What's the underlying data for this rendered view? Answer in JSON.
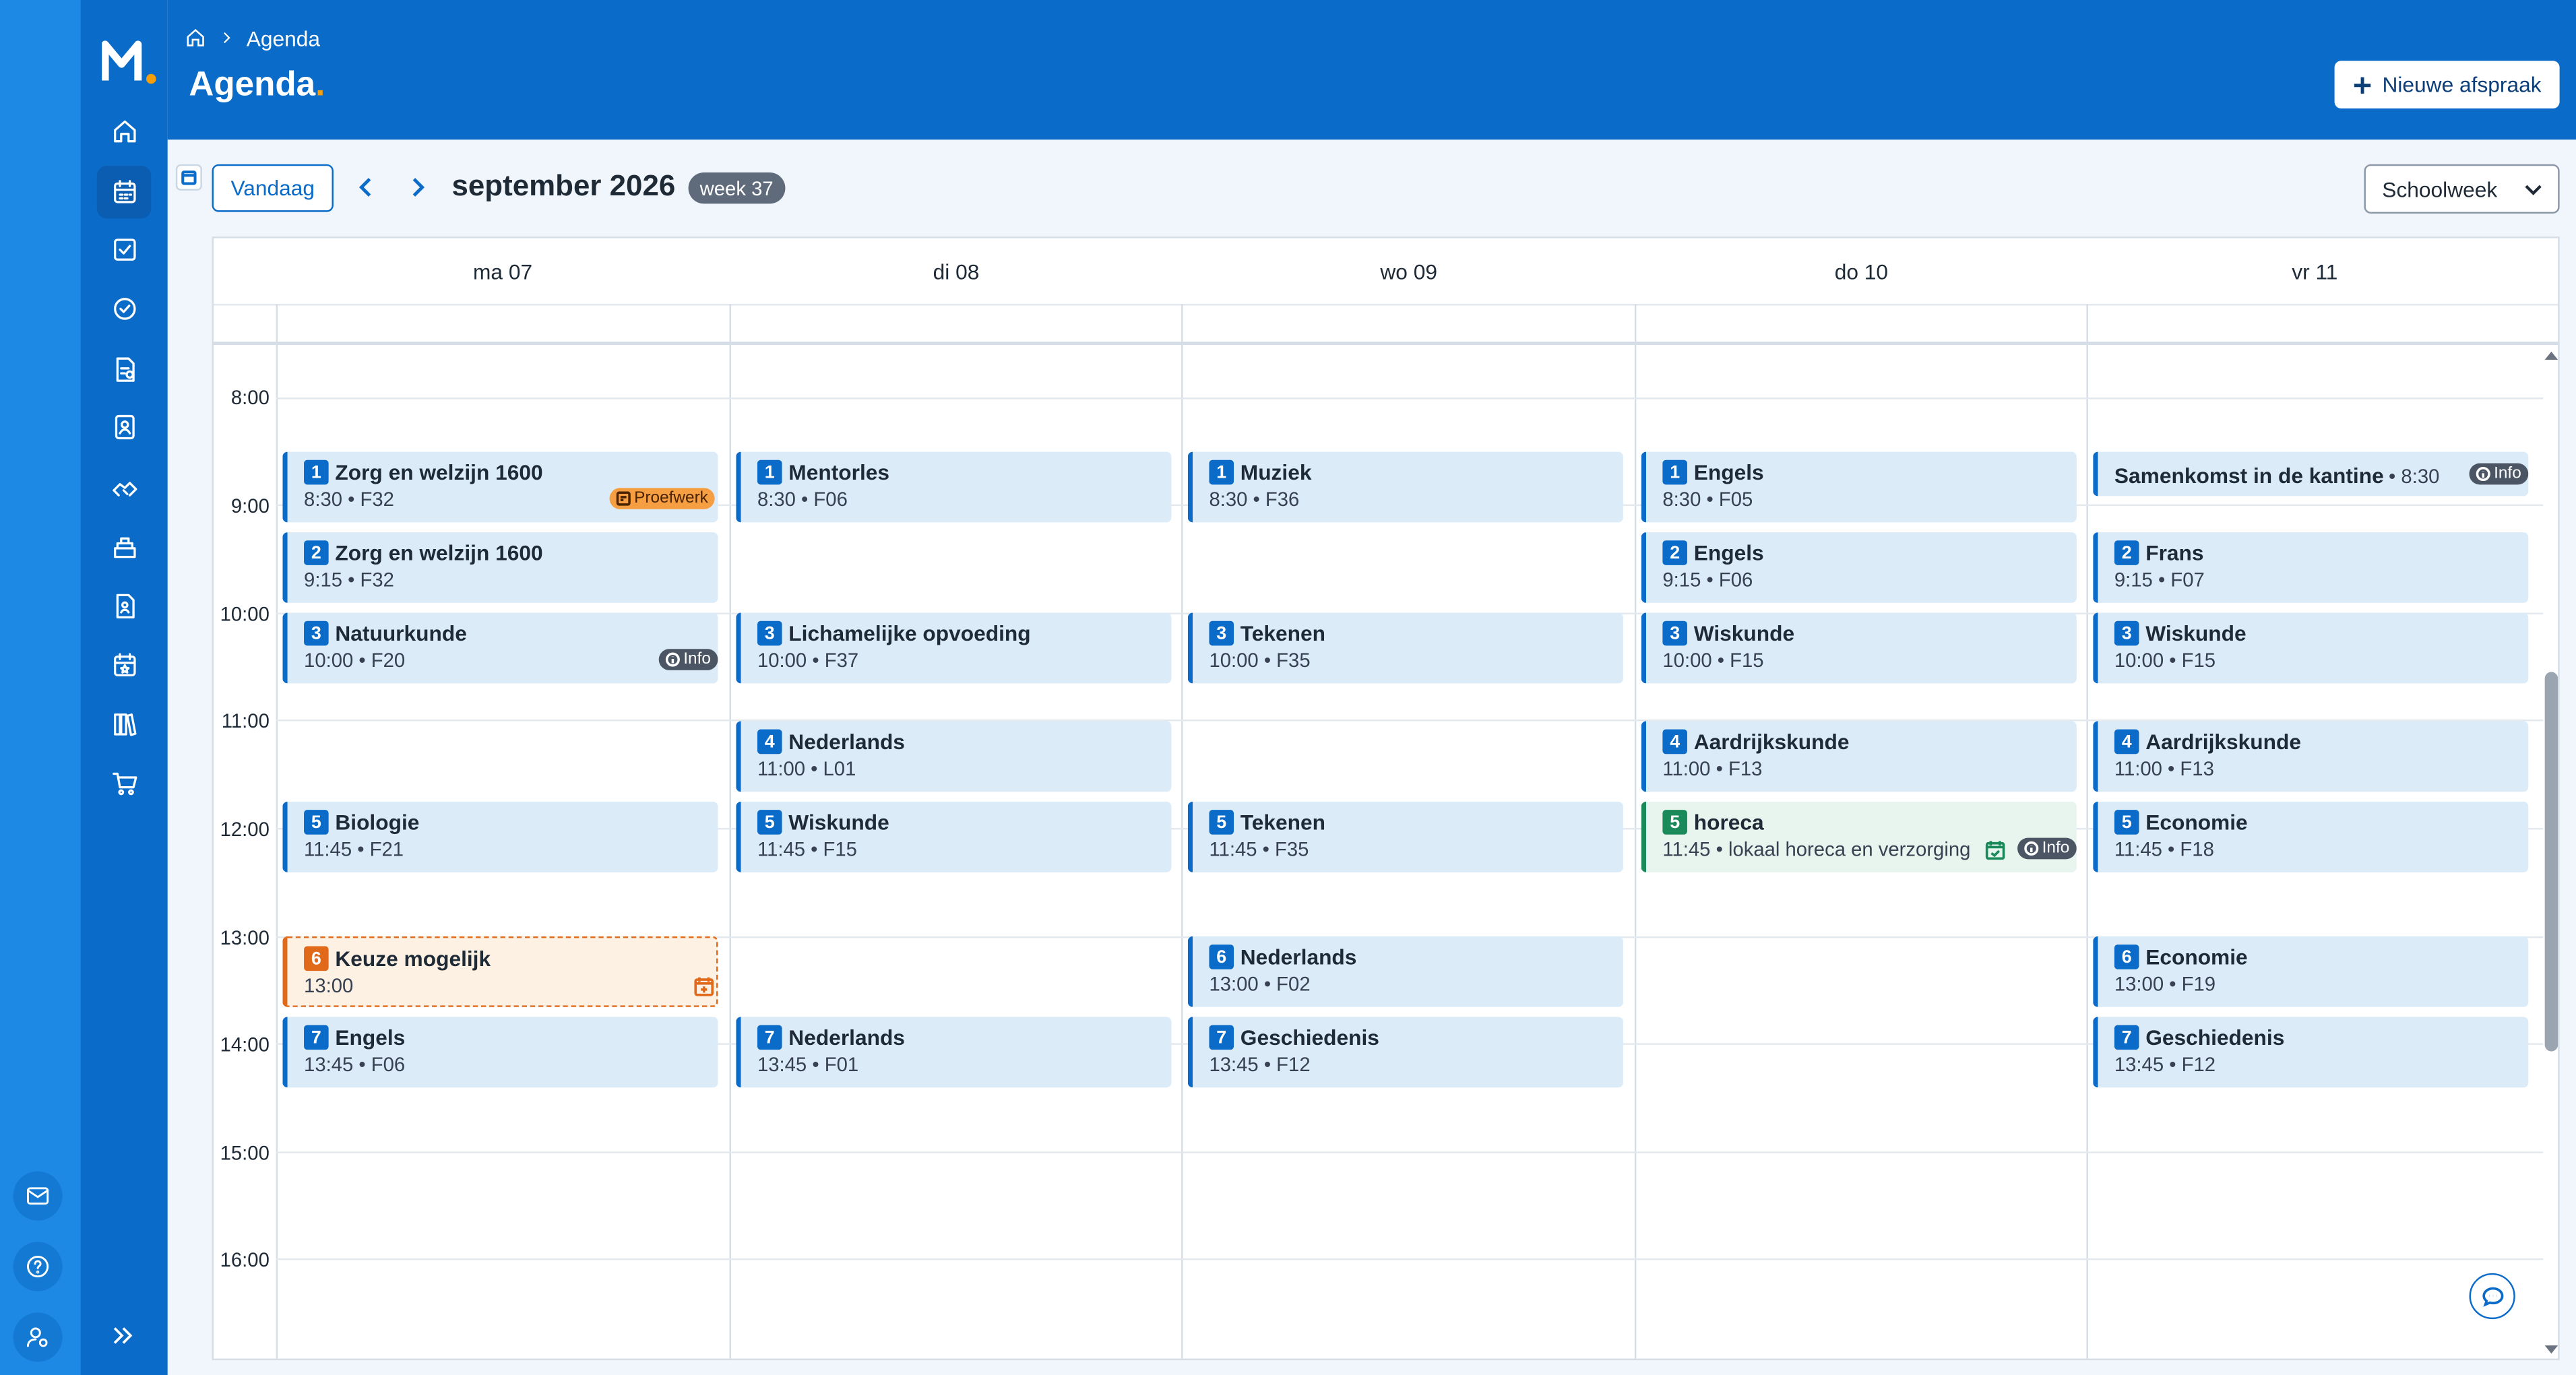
{
  "app": {
    "logo_letter": "M",
    "colors": {
      "primary": "#0b6bc9",
      "accent": "#f59e0b",
      "lesson_bg": "#dcebf8",
      "choice": "#e06a1a",
      "green": "#1a8a5a"
    }
  },
  "sidebar": {
    "items": [
      {
        "name": "home-icon",
        "label": "Home"
      },
      {
        "name": "calendar-icon",
        "label": "Agenda",
        "active": true
      },
      {
        "name": "checklist-icon",
        "label": "Taken"
      },
      {
        "name": "check-circle-icon",
        "label": "Afwezigheid"
      },
      {
        "name": "document-grade-icon",
        "label": "Cijfers"
      },
      {
        "name": "id-card-icon",
        "label": "Leerlingen"
      },
      {
        "name": "handshake-icon",
        "label": "Begeleiding"
      },
      {
        "name": "book-stack-icon",
        "label": "Studiewijzers"
      },
      {
        "name": "person-document-icon",
        "label": "Portfolio"
      },
      {
        "name": "calendar-star-icon",
        "label": "Activiteiten"
      },
      {
        "name": "books-icon",
        "label": "Leermiddelen"
      },
      {
        "name": "cart-icon",
        "label": "Bestellen"
      }
    ]
  },
  "header": {
    "breadcrumb": "Agenda",
    "title": "Agenda",
    "new_button": "Nieuwe afspraak"
  },
  "toolbar": {
    "today": "Vandaag",
    "month": "september 2026",
    "week": "week 37",
    "view": "Schoolweek"
  },
  "days": [
    {
      "label": "ma 07"
    },
    {
      "label": "di 08"
    },
    {
      "label": "wo 09"
    },
    {
      "label": "do 10"
    },
    {
      "label": "vr 11"
    }
  ],
  "hours": [
    "8:00",
    "9:00",
    "10:00",
    "11:00",
    "12:00",
    "13:00",
    "14:00",
    "15:00",
    "16:00"
  ],
  "events": {
    "ma": [
      {
        "num": "1",
        "title": "Zorg en welzijn 1600",
        "detail": "8:30 • F32",
        "tag": "Proefwerk"
      },
      {
        "num": "2",
        "title": "Zorg en welzijn 1600",
        "detail": "9:15 • F32"
      },
      {
        "num": "3",
        "title": "Natuurkunde",
        "detail": "10:00 • F20",
        "tag": "Info"
      },
      {
        "num": "5",
        "title": "Biologie",
        "detail": "11:45 • F21"
      },
      {
        "num": "6",
        "title": "Keuze mogelijk",
        "detail": "13:00"
      },
      {
        "num": "7",
        "title": "Engels",
        "detail": "13:45 • F06"
      }
    ],
    "di": [
      {
        "num": "1",
        "title": "Mentorles",
        "detail": "8:30 • F06"
      },
      {
        "num": "3",
        "title": "Lichamelijke opvoeding",
        "detail": "10:00 • F37"
      },
      {
        "num": "4",
        "title": "Nederlands",
        "detail": "11:00 • L01"
      },
      {
        "num": "5",
        "title": "Wiskunde",
        "detail": "11:45 • F15"
      },
      {
        "num": "7",
        "title": "Nederlands",
        "detail": "13:45 • F01"
      }
    ],
    "wo": [
      {
        "num": "1",
        "title": "Muziek",
        "detail": "8:30 • F36"
      },
      {
        "num": "3",
        "title": "Tekenen",
        "detail": "10:00 • F35"
      },
      {
        "num": "5",
        "title": "Tekenen",
        "detail": "11:45 • F35"
      },
      {
        "num": "6",
        "title": "Nederlands",
        "detail": "13:00 • F02"
      },
      {
        "num": "7",
        "title": "Geschiedenis",
        "detail": "13:45 • F12"
      }
    ],
    "do": [
      {
        "num": "1",
        "title": "Engels",
        "detail": "8:30 • F05"
      },
      {
        "num": "2",
        "title": "Engels",
        "detail": "9:15 • F06"
      },
      {
        "num": "3",
        "title": "Wiskunde",
        "detail": "10:00 • F15"
      },
      {
        "num": "4",
        "title": "Aardrijkskunde",
        "detail": "11:00 • F13"
      },
      {
        "num": "5",
        "title": "horeca",
        "detail": "11:45 • lokaal horeca en verzorging",
        "tag": "Info"
      }
    ],
    "vr": [
      {
        "title": "Samenkomst in de kantine",
        "time": "• 8:30",
        "tag": "Info"
      },
      {
        "num": "2",
        "title": "Frans",
        "detail": "9:15 • F07"
      },
      {
        "num": "3",
        "title": "Wiskunde",
        "detail": "10:00 • F15"
      },
      {
        "num": "4",
        "title": "Aardrijkskunde",
        "detail": "11:00 • F13"
      },
      {
        "num": "5",
        "title": "Economie",
        "detail": "11:45 • F18"
      },
      {
        "num": "6",
        "title": "Economie",
        "detail": "13:00 • F19"
      },
      {
        "num": "7",
        "title": "Geschiedenis",
        "detail": "13:45 • F12"
      }
    ]
  }
}
